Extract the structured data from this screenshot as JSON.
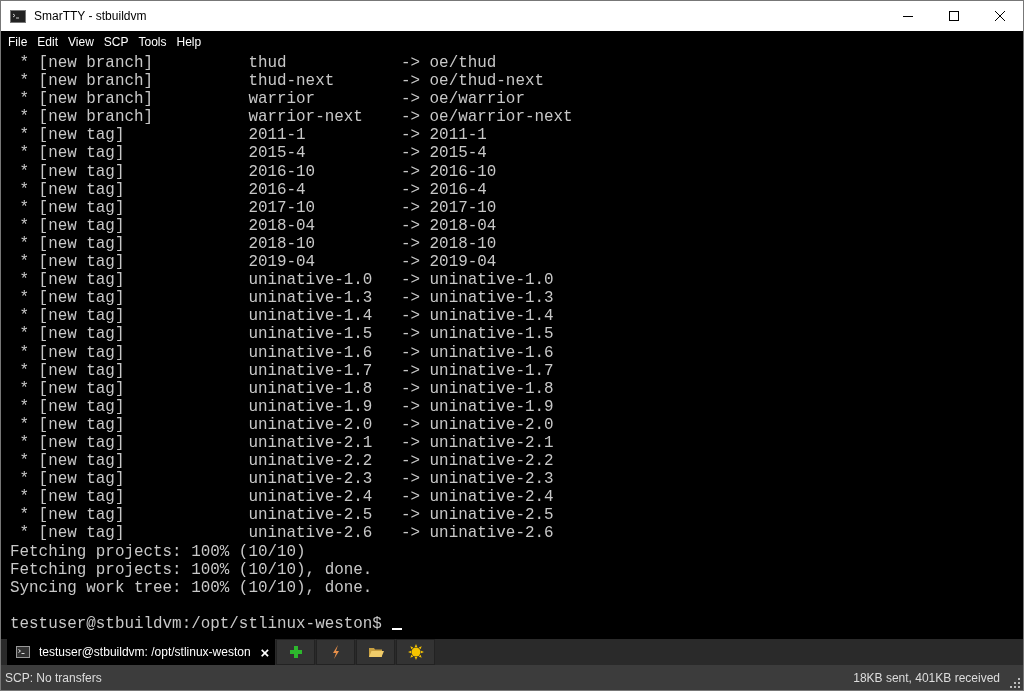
{
  "window": {
    "title": "SmarTTY - stbuildvm"
  },
  "menu": [
    "File",
    "Edit",
    "View",
    "SCP",
    "Tools",
    "Help"
  ],
  "terminal": {
    "lines": [
      " * [new branch]          thud            -> oe/thud",
      " * [new branch]          thud-next       -> oe/thud-next",
      " * [new branch]          warrior         -> oe/warrior",
      " * [new branch]          warrior-next    -> oe/warrior-next",
      " * [new tag]             2011-1          -> 2011-1",
      " * [new tag]             2015-4          -> 2015-4",
      " * [new tag]             2016-10         -> 2016-10",
      " * [new tag]             2016-4          -> 2016-4",
      " * [new tag]             2017-10         -> 2017-10",
      " * [new tag]             2018-04         -> 2018-04",
      " * [new tag]             2018-10         -> 2018-10",
      " * [new tag]             2019-04         -> 2019-04",
      " * [new tag]             uninative-1.0   -> uninative-1.0",
      " * [new tag]             uninative-1.3   -> uninative-1.3",
      " * [new tag]             uninative-1.4   -> uninative-1.4",
      " * [new tag]             uninative-1.5   -> uninative-1.5",
      " * [new tag]             uninative-1.6   -> uninative-1.6",
      " * [new tag]             uninative-1.7   -> uninative-1.7",
      " * [new tag]             uninative-1.8   -> uninative-1.8",
      " * [new tag]             uninative-1.9   -> uninative-1.9",
      " * [new tag]             uninative-2.0   -> uninative-2.0",
      " * [new tag]             uninative-2.1   -> uninative-2.1",
      " * [new tag]             uninative-2.2   -> uninative-2.2",
      " * [new tag]             uninative-2.3   -> uninative-2.3",
      " * [new tag]             uninative-2.4   -> uninative-2.4",
      " * [new tag]             uninative-2.5   -> uninative-2.5",
      " * [new tag]             uninative-2.6   -> uninative-2.6",
      "Fetching projects: 100% (10/10)",
      "Fetching projects: 100% (10/10), done.",
      "Syncing work tree: 100% (10/10), done."
    ],
    "prompt": "testuser@stbuildvm:/opt/stlinux-weston$"
  },
  "tabs": [
    {
      "label": "testuser@stbuildvm: /opt/stlinux-weston",
      "close": "×",
      "selected": true
    }
  ],
  "toolbar": [
    {
      "kind": "plus"
    },
    {
      "kind": "bolt"
    },
    {
      "kind": "folder"
    },
    {
      "kind": "sun"
    }
  ],
  "status_bar": {
    "left": "SCP: No transfers",
    "right": "18KB sent, 401KB received"
  }
}
